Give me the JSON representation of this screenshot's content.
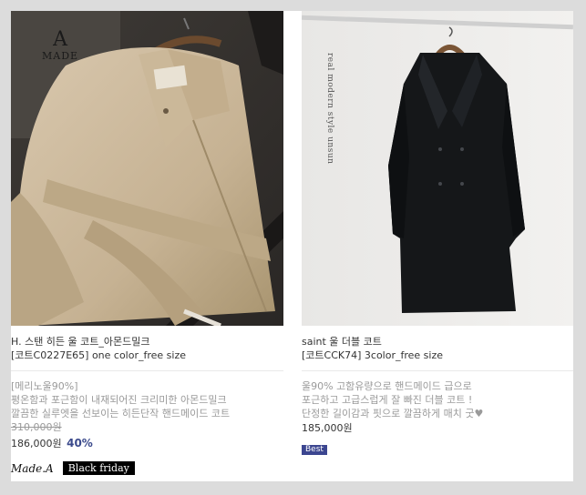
{
  "products": [
    {
      "brand_mark_big": "A",
      "brand_mark_small": "MADE",
      "name": "H. 스탠 히든 울 코트_아몬드밀크",
      "code_line": "[코트C0227E65] one color_free size",
      "desc_lines": [
        "[메리노울90%]",
        "평온함과 포근함이 내재되어진 크리미한 아몬드밀크",
        "깔끔한 실루엣을 선보이는 히든단작 핸드메이드 코트"
      ],
      "old_price": "310,000원",
      "price": "186,000원",
      "discount": "40%",
      "logo_text": "Made.A",
      "badge": "Black friday"
    },
    {
      "vertical_text": "real modern style unsun",
      "name": "saint 울 더블 코트",
      "code_line": "[코트CCK74] 3color_free size",
      "desc_lines": [
        "울90% 고함유량으로 핸드메이드 급으로",
        "포근하고 고급스럽게 잘 빠진 더블 코트 !",
        "단정한 길이감과 핏으로 깔끔하게 매치 굿♥"
      ],
      "price": "185,000원",
      "badge": "Best"
    }
  ],
  "colors": {
    "accent": "#3b4a8c",
    "best_badge": "#3c4690",
    "background": "#dcdcdc"
  }
}
